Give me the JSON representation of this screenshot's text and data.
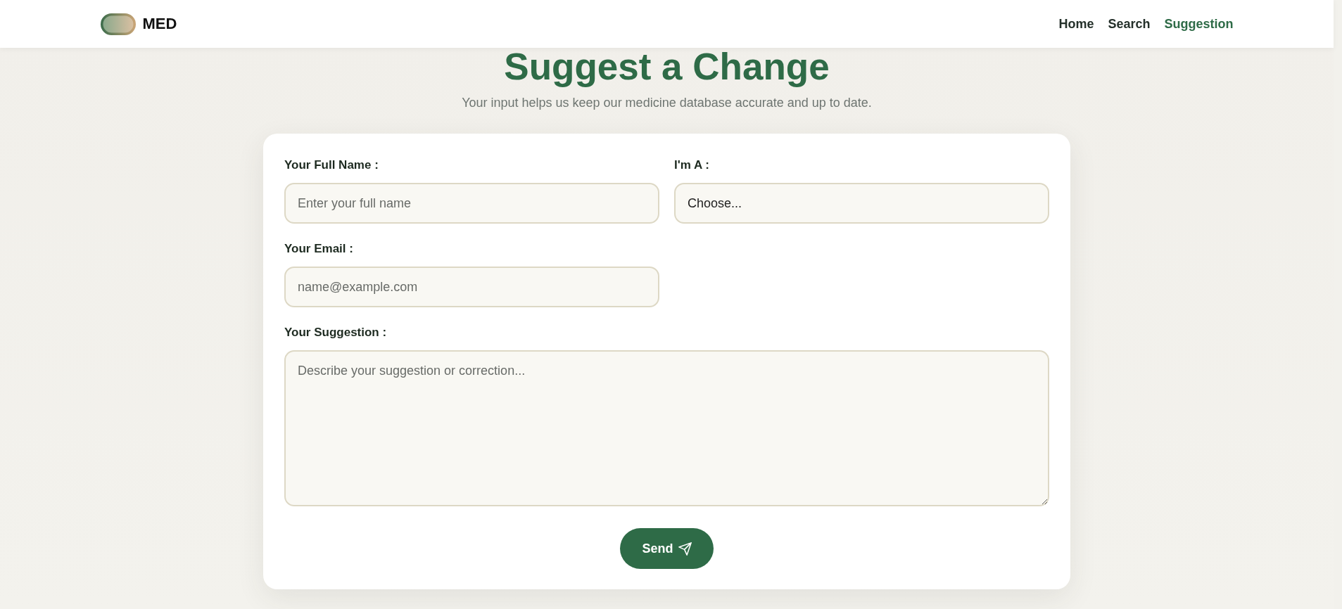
{
  "header": {
    "logo": {
      "text": "MED"
    },
    "nav": [
      {
        "label": "Home",
        "selected": false
      },
      {
        "label": "Search",
        "selected": false
      },
      {
        "label": "Suggestion",
        "selected": true
      }
    ]
  },
  "page": {
    "title": "Suggest a Change",
    "subtitle": "Your input helps us keep our medicine database accurate and up to date."
  },
  "form": {
    "fields": [
      {
        "kind": "text",
        "label": "Your Full Name :",
        "placeholder": "Enter your full name"
      },
      {
        "kind": "select",
        "label": "I'm A :",
        "value": "Choose..."
      },
      {
        "kind": "email",
        "label": "Your Email :",
        "placeholder": "name@example.com"
      },
      {
        "kind": "textarea",
        "label": "Your Suggestion :",
        "placeholder": "Describe your suggestion or correction..."
      }
    ],
    "submit": {
      "label": "Send"
    }
  }
}
